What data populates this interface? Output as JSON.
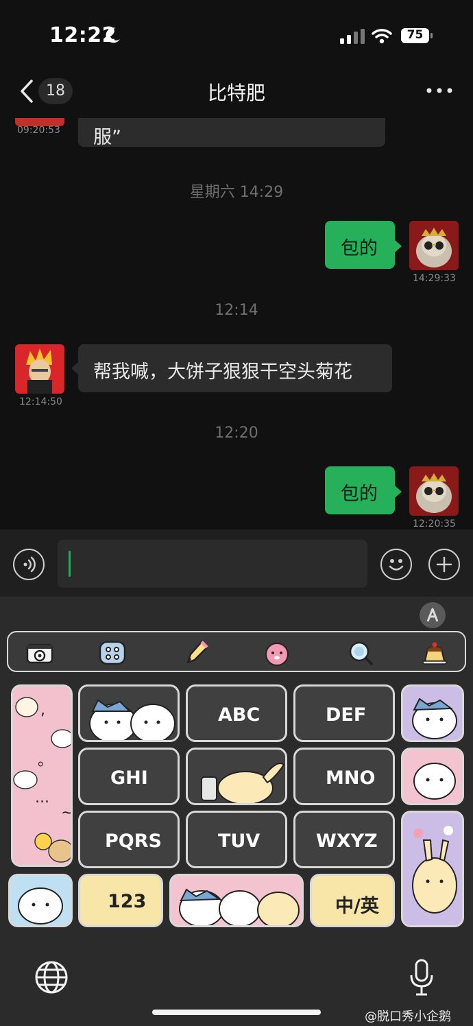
{
  "status_bar": {
    "time": "12:22",
    "battery": "75"
  },
  "nav": {
    "unread_count": "18",
    "title": "比特肥"
  },
  "messages": {
    "top_partial": {
      "text": "服”",
      "time": "09:20:53"
    },
    "divider_1": "星期六 14:29",
    "out_1": {
      "text": "包的",
      "time": "14:29:33"
    },
    "divider_2": "12:14",
    "in_1": {
      "text": "帮我喊，大饼子狠狠干空头菊花",
      "time": "12:14:50"
    },
    "divider_3": "12:20",
    "out_2": {
      "text": "包的",
      "time": "12:20:35"
    }
  },
  "keyboard": {
    "keys": {
      "abc": "ABC",
      "def": "DEF",
      "ghi": "GHI",
      "mno": "MNO",
      "pqrs": "PQRS",
      "tuv": "TUV",
      "wxyz": "WXYZ",
      "num": "123",
      "lang": "中/英"
    },
    "punct": [
      ",",
      "。",
      "?",
      "!",
      "...",
      "~"
    ]
  },
  "watermark": "@脱口秀小企鹅",
  "colors": {
    "accent_green": "#26b05a",
    "bubble_in": "#2c2c2c",
    "background": "#111111"
  }
}
